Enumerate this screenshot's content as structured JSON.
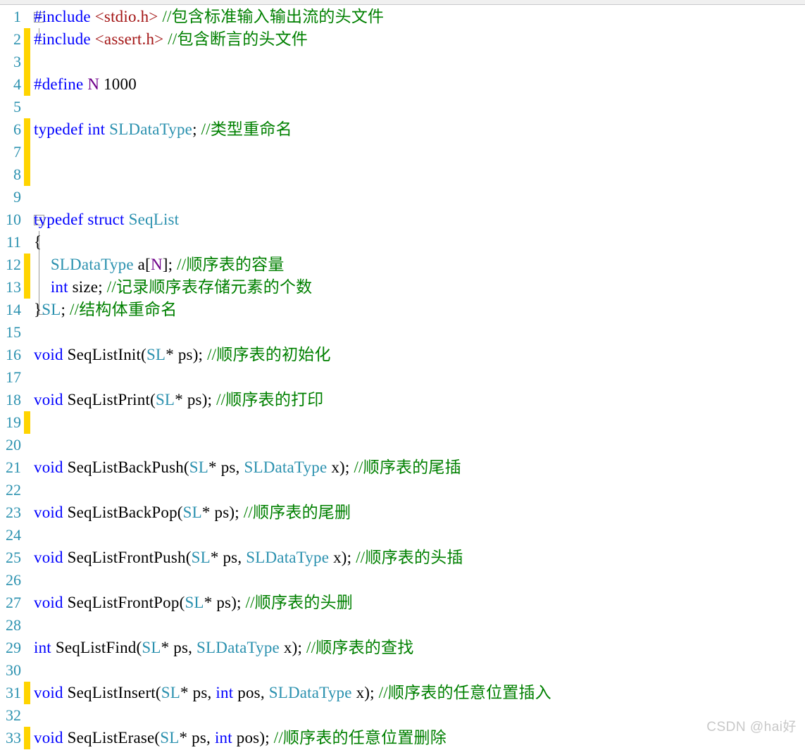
{
  "editor": {
    "language": "c-header",
    "colors": {
      "background": "#ffffff",
      "line_number": "#2b91af",
      "change_bar": "#ffd400",
      "keyword": "#0000ff",
      "string": "#a31515",
      "comment": "#008000",
      "user_type": "#2b91af",
      "macro": "#6f008a",
      "plain_text": "#000000",
      "fold_guide": "#9a9a9a",
      "watermark": "#c8c8c8"
    },
    "lines": [
      {
        "n": "1",
        "changed": false,
        "fold": "start",
        "tokens": [
          {
            "t": "#include ",
            "c": "kw"
          },
          {
            "t": "<stdio.h>",
            "c": "str"
          },
          {
            "t": " ",
            "c": "pln"
          },
          {
            "t": "//包含标准输入输出流的头文件",
            "c": "cmt"
          }
        ]
      },
      {
        "n": "2",
        "changed": true,
        "fold": "end",
        "tokens": [
          {
            "t": "#include ",
            "c": "kw"
          },
          {
            "t": "<assert.h>",
            "c": "str"
          },
          {
            "t": " ",
            "c": "pln"
          },
          {
            "t": "//包含断言的头文件",
            "c": "cmt"
          }
        ]
      },
      {
        "n": "3",
        "changed": true,
        "fold": "none",
        "tokens": []
      },
      {
        "n": "4",
        "changed": true,
        "fold": "none",
        "tokens": [
          {
            "t": "#define ",
            "c": "kw"
          },
          {
            "t": "N",
            "c": "mac"
          },
          {
            "t": " 1000",
            "c": "pln"
          }
        ]
      },
      {
        "n": "5",
        "changed": false,
        "fold": "none",
        "tokens": []
      },
      {
        "n": "6",
        "changed": true,
        "fold": "none",
        "tokens": [
          {
            "t": "typedef",
            "c": "kw"
          },
          {
            "t": " ",
            "c": "pln"
          },
          {
            "t": "int",
            "c": "kw"
          },
          {
            "t": " ",
            "c": "pln"
          },
          {
            "t": "SLDataType",
            "c": "type"
          },
          {
            "t": "; ",
            "c": "pln"
          },
          {
            "t": "//类型重命名",
            "c": "cmt"
          }
        ]
      },
      {
        "n": "7",
        "changed": true,
        "fold": "none",
        "tokens": []
      },
      {
        "n": "8",
        "changed": true,
        "fold": "none",
        "tokens": []
      },
      {
        "n": "9",
        "changed": false,
        "fold": "none",
        "tokens": []
      },
      {
        "n": "10",
        "changed": false,
        "fold": "start",
        "tokens": [
          {
            "t": "typedef",
            "c": "kw"
          },
          {
            "t": " ",
            "c": "pln"
          },
          {
            "t": "struct",
            "c": "kw"
          },
          {
            "t": " ",
            "c": "pln"
          },
          {
            "t": "SeqList",
            "c": "type"
          }
        ]
      },
      {
        "n": "11",
        "changed": false,
        "fold": "mid",
        "tokens": [
          {
            "t": "{",
            "c": "pln"
          }
        ]
      },
      {
        "n": "12",
        "changed": true,
        "fold": "mid",
        "tokens": [
          {
            "t": "    ",
            "c": "pln"
          },
          {
            "t": "SLDataType",
            "c": "type"
          },
          {
            "t": " a[",
            "c": "pln"
          },
          {
            "t": "N",
            "c": "mac"
          },
          {
            "t": "]; ",
            "c": "pln"
          },
          {
            "t": "//顺序表的容量",
            "c": "cmt"
          }
        ]
      },
      {
        "n": "13",
        "changed": true,
        "fold": "mid",
        "tokens": [
          {
            "t": "    ",
            "c": "pln"
          },
          {
            "t": "int",
            "c": "kw"
          },
          {
            "t": " size; ",
            "c": "pln"
          },
          {
            "t": "//记录顺序表存储元素的个数",
            "c": "cmt"
          }
        ]
      },
      {
        "n": "14",
        "changed": false,
        "fold": "end",
        "tokens": [
          {
            "t": "}",
            "c": "pln"
          },
          {
            "t": "SL",
            "c": "type"
          },
          {
            "t": "; ",
            "c": "pln"
          },
          {
            "t": "//结构体重命名",
            "c": "cmt"
          }
        ]
      },
      {
        "n": "15",
        "changed": false,
        "fold": "none",
        "tokens": []
      },
      {
        "n": "16",
        "changed": false,
        "fold": "none",
        "tokens": [
          {
            "t": "void",
            "c": "kw"
          },
          {
            "t": " SeqListInit(",
            "c": "pln"
          },
          {
            "t": "SL",
            "c": "type"
          },
          {
            "t": "* ps); ",
            "c": "pln"
          },
          {
            "t": "//顺序表的初始化",
            "c": "cmt"
          }
        ]
      },
      {
        "n": "17",
        "changed": false,
        "fold": "none",
        "tokens": []
      },
      {
        "n": "18",
        "changed": false,
        "fold": "none",
        "tokens": [
          {
            "t": "void",
            "c": "kw"
          },
          {
            "t": " SeqListPrint(",
            "c": "pln"
          },
          {
            "t": "SL",
            "c": "type"
          },
          {
            "t": "* ps); ",
            "c": "pln"
          },
          {
            "t": "//顺序表的打印",
            "c": "cmt"
          }
        ]
      },
      {
        "n": "19",
        "changed": true,
        "fold": "none",
        "tokens": []
      },
      {
        "n": "20",
        "changed": false,
        "fold": "none",
        "tokens": []
      },
      {
        "n": "21",
        "changed": false,
        "fold": "none",
        "tokens": [
          {
            "t": "void",
            "c": "kw"
          },
          {
            "t": " SeqListBackPush(",
            "c": "pln"
          },
          {
            "t": "SL",
            "c": "type"
          },
          {
            "t": "* ps, ",
            "c": "pln"
          },
          {
            "t": "SLDataType",
            "c": "type"
          },
          {
            "t": " x); ",
            "c": "pln"
          },
          {
            "t": "//顺序表的尾插",
            "c": "cmt"
          }
        ]
      },
      {
        "n": "22",
        "changed": false,
        "fold": "none",
        "tokens": []
      },
      {
        "n": "23",
        "changed": false,
        "fold": "none",
        "tokens": [
          {
            "t": "void",
            "c": "kw"
          },
          {
            "t": " SeqListBackPop(",
            "c": "pln"
          },
          {
            "t": "SL",
            "c": "type"
          },
          {
            "t": "* ps); ",
            "c": "pln"
          },
          {
            "t": "//顺序表的尾删",
            "c": "cmt"
          }
        ]
      },
      {
        "n": "24",
        "changed": false,
        "fold": "none",
        "tokens": []
      },
      {
        "n": "25",
        "changed": false,
        "fold": "none",
        "tokens": [
          {
            "t": "void",
            "c": "kw"
          },
          {
            "t": " SeqListFrontPush(",
            "c": "pln"
          },
          {
            "t": "SL",
            "c": "type"
          },
          {
            "t": "* ps, ",
            "c": "pln"
          },
          {
            "t": "SLDataType",
            "c": "type"
          },
          {
            "t": " x); ",
            "c": "pln"
          },
          {
            "t": "//顺序表的头插",
            "c": "cmt"
          }
        ]
      },
      {
        "n": "26",
        "changed": false,
        "fold": "none",
        "tokens": []
      },
      {
        "n": "27",
        "changed": false,
        "fold": "none",
        "tokens": [
          {
            "t": "void",
            "c": "kw"
          },
          {
            "t": " SeqListFrontPop(",
            "c": "pln"
          },
          {
            "t": "SL",
            "c": "type"
          },
          {
            "t": "* ps); ",
            "c": "pln"
          },
          {
            "t": "//顺序表的头删",
            "c": "cmt"
          }
        ]
      },
      {
        "n": "28",
        "changed": false,
        "fold": "none",
        "tokens": []
      },
      {
        "n": "29",
        "changed": false,
        "fold": "none",
        "tokens": [
          {
            "t": "int",
            "c": "kw"
          },
          {
            "t": " SeqListFind(",
            "c": "pln"
          },
          {
            "t": "SL",
            "c": "type"
          },
          {
            "t": "* ps, ",
            "c": "pln"
          },
          {
            "t": "SLDataType",
            "c": "type"
          },
          {
            "t": " x); ",
            "c": "pln"
          },
          {
            "t": "//顺序表的查找",
            "c": "cmt"
          }
        ]
      },
      {
        "n": "30",
        "changed": false,
        "fold": "none",
        "tokens": []
      },
      {
        "n": "31",
        "changed": true,
        "fold": "none",
        "tokens": [
          {
            "t": "void",
            "c": "kw"
          },
          {
            "t": " SeqListInsert(",
            "c": "pln"
          },
          {
            "t": "SL",
            "c": "type"
          },
          {
            "t": "* ps, ",
            "c": "pln"
          },
          {
            "t": "int",
            "c": "kw"
          },
          {
            "t": " pos, ",
            "c": "pln"
          },
          {
            "t": "SLDataType",
            "c": "type"
          },
          {
            "t": " x); ",
            "c": "pln"
          },
          {
            "t": "//顺序表的任意位置插入",
            "c": "cmt"
          }
        ]
      },
      {
        "n": "32",
        "changed": false,
        "fold": "none",
        "tokens": []
      },
      {
        "n": "33",
        "changed": true,
        "fold": "none",
        "tokens": [
          {
            "t": "void",
            "c": "kw"
          },
          {
            "t": " SeqListErase(",
            "c": "pln"
          },
          {
            "t": "SL",
            "c": "type"
          },
          {
            "t": "* ps, ",
            "c": "pln"
          },
          {
            "t": "int",
            "c": "kw"
          },
          {
            "t": " pos); ",
            "c": "pln"
          },
          {
            "t": "//顺序表的任意位置删除",
            "c": "cmt"
          }
        ]
      }
    ]
  },
  "watermark": {
    "text": "CSDN @hai好"
  }
}
